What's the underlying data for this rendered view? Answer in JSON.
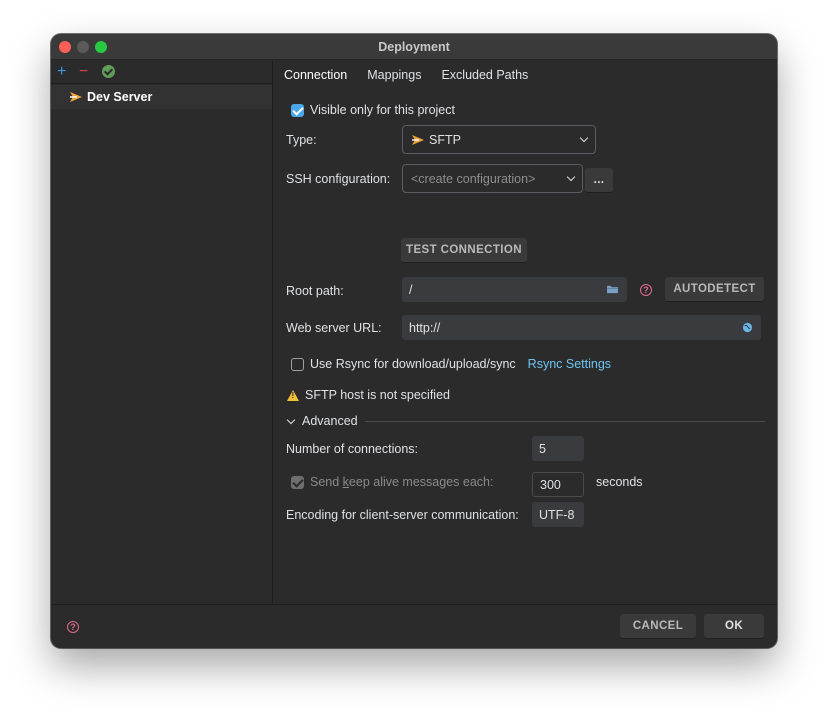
{
  "window": {
    "title": "Deployment"
  },
  "sidebar": {
    "toolbar": {
      "add": "+",
      "remove": "−"
    },
    "items": [
      {
        "label": "Dev Server"
      }
    ]
  },
  "tabs": [
    {
      "label": "Connection"
    },
    {
      "label": "Mappings"
    },
    {
      "label": "Excluded Paths"
    }
  ],
  "connection": {
    "visible_only_label": "Visible only for this project",
    "type_label": "Type:",
    "type_value": "SFTP",
    "ssh_label": "SSH configuration:",
    "ssh_placeholder": "<create configuration>",
    "ssh_more": "...",
    "test_connection": "TEST CONNECTION",
    "root_path_label": "Root path:",
    "root_path_value": "/",
    "autodetect": "AUTODETECT",
    "web_url_label": "Web server URL:",
    "web_url_value": "http://",
    "rsync_label": "Use Rsync for download/upload/sync",
    "rsync_settings": "Rsync Settings",
    "warning": "SFTP host is not specified"
  },
  "advanced": {
    "header": "Advanced",
    "connections_label": "Number of connections:",
    "connections_value": "5",
    "keepalive_label_pre": "Send ",
    "keepalive_label_underline": "k",
    "keepalive_label_post": "eep alive messages each:",
    "keepalive_value": "300",
    "keepalive_unit": "seconds",
    "encoding_label": "Encoding for client-server communication:",
    "encoding_value": "UTF-8"
  },
  "footer": {
    "cancel": "CANCEL",
    "ok": "OK"
  },
  "colors": {
    "accent": "#4aa8e9",
    "link": "#6cc5f0",
    "warning": "#f2c037",
    "help": "#e06c8e"
  }
}
